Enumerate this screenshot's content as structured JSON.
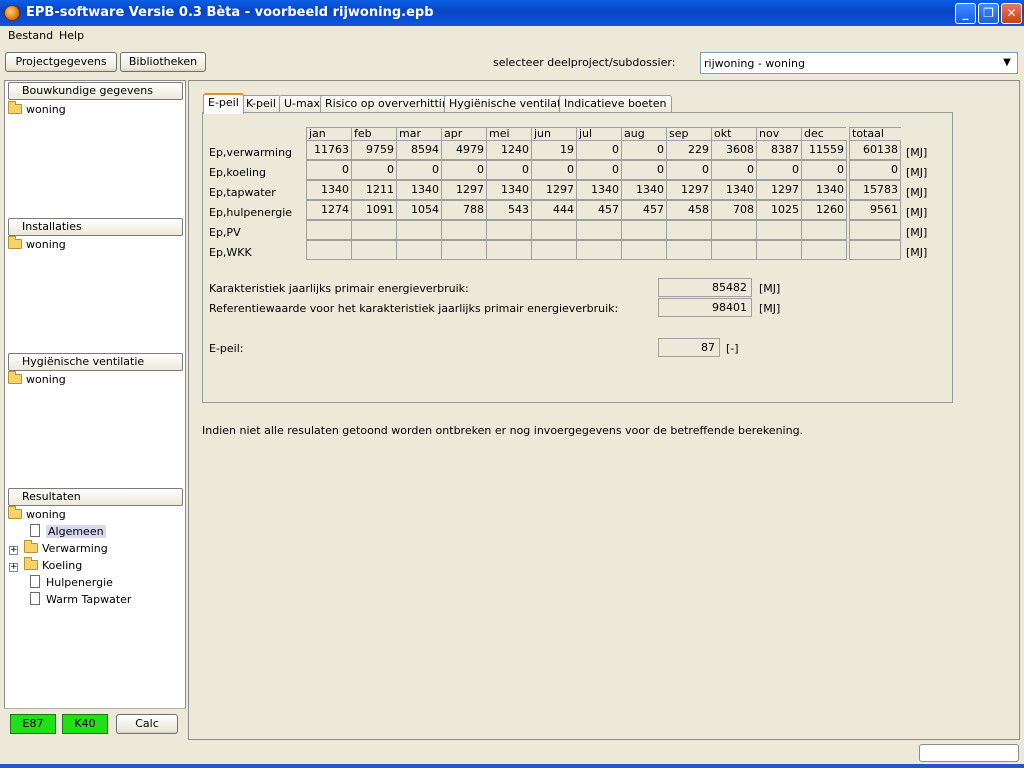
{
  "window": {
    "title": "EPB-software Versie 0.3 Bèta - voorbeeld rijwoning.epb",
    "minimize": "_",
    "maximize": "❐",
    "close": "✕"
  },
  "menu": [
    "Bestand",
    "Help"
  ],
  "toolbar": {
    "projectgegevens": "Projectgegevens",
    "bibliotheken": "Bibliotheken",
    "select_label": "selecteer deelproject/subdossier:",
    "select_value": "rijwoning - woning"
  },
  "sidebar": {
    "bouwkundig": {
      "label": "Bouwkundige gegevens",
      "items": [
        "woning"
      ]
    },
    "installaties": {
      "label": "Installaties",
      "items": [
        "woning"
      ]
    },
    "ventilatie": {
      "label": "Hygiënische ventilatie",
      "items": [
        "woning"
      ]
    },
    "resultaten": {
      "label": "Resultaten",
      "root": "woning",
      "items": [
        "Algemeen",
        "Verwarming",
        "Koeling",
        "Hulpenergie",
        "Warm Tapwater"
      ]
    },
    "status": {
      "e": "E87",
      "k": "K40",
      "calc": "Calc"
    }
  },
  "tabs": [
    "E-peil",
    "K-peil",
    "U-max",
    "Risico op oververhitting",
    "Hygiënische ventilatie",
    "Indicatieve boeten"
  ],
  "table": {
    "months": [
      "jan",
      "feb",
      "mar",
      "apr",
      "mei",
      "jun",
      "jul",
      "aug",
      "sep",
      "okt",
      "nov",
      "dec"
    ],
    "total_label": "totaal",
    "unit": "[MJ]",
    "rows": [
      {
        "label": "Ep,verwarming",
        "values": [
          "11763",
          "9759",
          "8594",
          "4979",
          "1240",
          "19",
          "0",
          "0",
          "229",
          "3608",
          "8387",
          "11559"
        ],
        "total": "60138"
      },
      {
        "label": "Ep,koeling",
        "values": [
          "0",
          "0",
          "0",
          "0",
          "0",
          "0",
          "0",
          "0",
          "0",
          "0",
          "0",
          "0"
        ],
        "total": "0"
      },
      {
        "label": "Ep,tapwater",
        "values": [
          "1340",
          "1211",
          "1340",
          "1297",
          "1340",
          "1297",
          "1340",
          "1340",
          "1297",
          "1340",
          "1297",
          "1340"
        ],
        "total": "15783"
      },
      {
        "label": "Ep,hulpenergie",
        "values": [
          "1274",
          "1091",
          "1054",
          "788",
          "543",
          "444",
          "457",
          "457",
          "458",
          "708",
          "1025",
          "1260"
        ],
        "total": "9561"
      },
      {
        "label": "Ep,PV",
        "values": [
          "",
          "",
          "",
          "",
          "",
          "",
          "",
          "",
          "",
          "",
          "",
          ""
        ],
        "total": ""
      },
      {
        "label": "Ep,WKK",
        "values": [
          "",
          "",
          "",
          "",
          "",
          "",
          "",
          "",
          "",
          "",
          "",
          ""
        ],
        "total": ""
      }
    ]
  },
  "summary": {
    "kar_label": "Karakteristiek jaarlijks primair energieverbruik:",
    "kar_value": "85482",
    "kar_unit": "[MJ]",
    "ref_label": "Referentiewaarde voor het karakteristiek jaarlijks primair energieverbruik:",
    "ref_value": "98401",
    "ref_unit": "[MJ]",
    "epeil_label": "E-peil:",
    "epeil_value": "87",
    "epeil_unit": "[-]"
  },
  "note": "Indien niet alle resulaten getoond worden ontbreken er nog invoergegevens voor de betreffende berekening."
}
